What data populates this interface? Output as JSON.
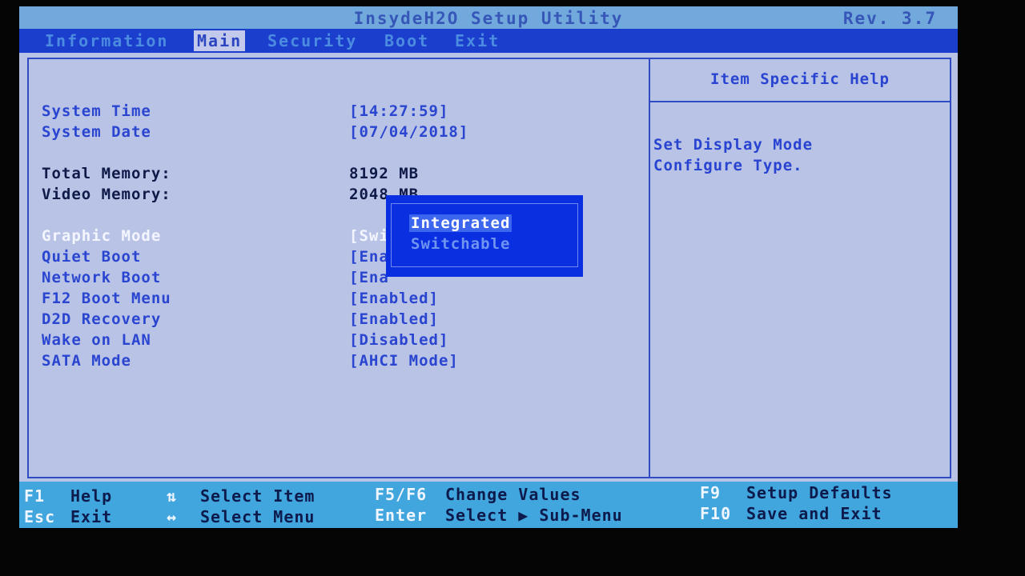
{
  "title": "InsydeH2O Setup Utility",
  "revision": "Rev. 3.7",
  "tabs": [
    {
      "label": "Information",
      "active": false
    },
    {
      "label": "Main",
      "active": true
    },
    {
      "label": "Security",
      "active": false
    },
    {
      "label": "Boot",
      "active": false
    },
    {
      "label": "Exit",
      "active": false
    }
  ],
  "main": {
    "settings": [
      {
        "label": "System Time",
        "value": "[14:27:59]"
      },
      {
        "label": "System Date",
        "value": "[07/04/2018]"
      },
      {
        "label": "Total Memory:",
        "value": "8192 MB"
      },
      {
        "label": "Video Memory:",
        "value": "2048 MB"
      },
      {
        "label": "Graphic Mode",
        "value": "[Swi"
      },
      {
        "label": "Quiet Boot",
        "value": "[Ena"
      },
      {
        "label": "Network Boot",
        "value": "[Ena"
      },
      {
        "label": "F12 Boot Menu",
        "value": "[Enabled]"
      },
      {
        "label": "D2D Recovery",
        "value": "[Enabled]"
      },
      {
        "label": "Wake on LAN",
        "value": "[Disabled]"
      },
      {
        "label": "SATA Mode",
        "value": "[AHCI Mode]"
      }
    ]
  },
  "popup": {
    "options": [
      "Integrated",
      "Switchable"
    ],
    "selected": "Integrated"
  },
  "help": {
    "title": "Item Specific Help",
    "lines": [
      "Set Display Mode",
      "Configure Type."
    ]
  },
  "footer": {
    "f1_key": "F1",
    "f1_desc": "Help",
    "esc_key": "Esc",
    "esc_desc": "Exit",
    "updown_key": "⇅",
    "updown_desc": "Select Item",
    "leftright_key": "↔",
    "leftright_desc": "Select Menu",
    "f5f6_key": "F5/F6",
    "f5f6_desc": "Change Values",
    "enter_key": "Enter",
    "enter_desc": "Select ▶ Sub-Menu",
    "f9_key": "F9",
    "f9_desc": "Setup Defaults",
    "f10_key": "F10",
    "f10_desc": "Save and Exit"
  },
  "colors": {
    "background": "#b9c3e6",
    "title_bar": "#72a9dd",
    "tab_bar": "#1b3ecd",
    "popup": "#0a2fe0",
    "footer": "#42a6de",
    "text_blue": "#2a45d0"
  }
}
